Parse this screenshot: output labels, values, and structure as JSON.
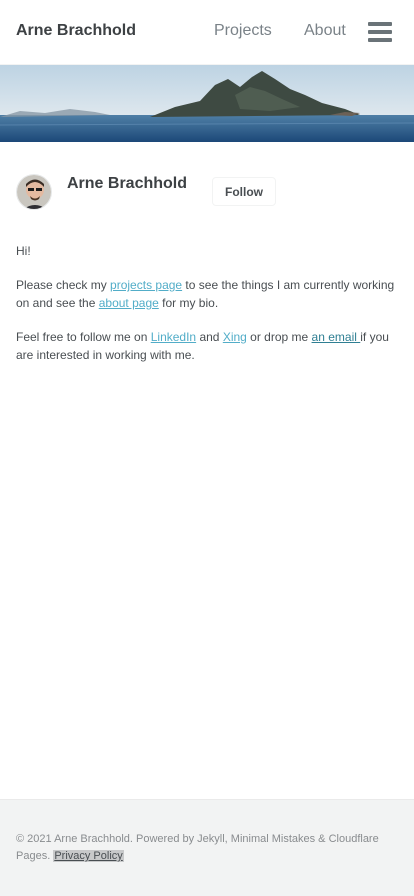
{
  "header": {
    "site_title": "Arne Brachhold",
    "nav": {
      "projects": "Projects",
      "about": "About"
    },
    "menu_icon": "hamburger-menu-icon"
  },
  "author": {
    "name": "Arne Brachhold",
    "follow_label": "Follow"
  },
  "content": {
    "greeting": "Hi!",
    "para1": {
      "before": "Please check my ",
      "link1": "projects page",
      "middle": " to see the things I am currently working on and see the ",
      "link2": "about page",
      "after": " for my bio."
    },
    "para2": {
      "before": "Feel free to follow me on ",
      "link1": "LinkedIn",
      "and": " and ",
      "link2": "Xing",
      "middle": " or drop me ",
      "link3": "an email ",
      "after": "if you are interested in working with me."
    }
  },
  "footer": {
    "text": "© 2021 Arne Brachhold. Powered by Jekyll, Minimal Mistakes & Cloudflare Pages. ",
    "privacy_label": "Privacy Policy"
  },
  "colors": {
    "link": "#52adc8",
    "footer_bg": "#f2f3f3"
  }
}
